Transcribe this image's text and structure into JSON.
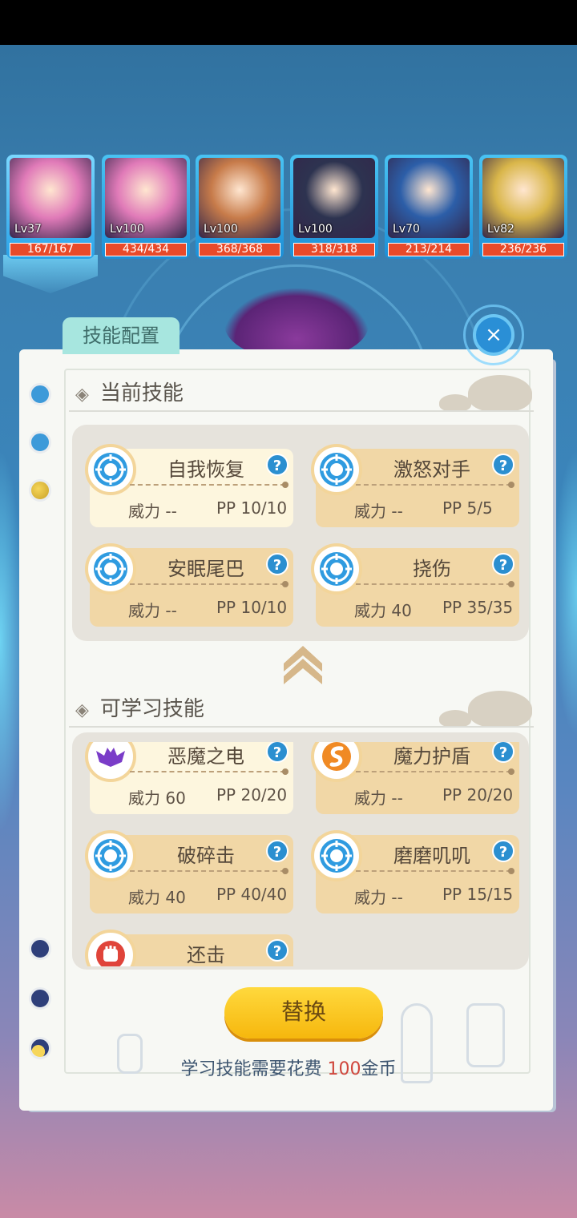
{
  "team": [
    {
      "level": "Lv37",
      "hp": "167/167",
      "active": true,
      "color": "#e07ab8"
    },
    {
      "level": "Lv100",
      "hp": "434/434",
      "active": false,
      "color": "#e07ab8"
    },
    {
      "level": "Lv100",
      "hp": "368/368",
      "active": false,
      "color": "#c77b4a"
    },
    {
      "level": "Lv100",
      "hp": "318/318",
      "active": false,
      "color": "#2d3350"
    },
    {
      "level": "Lv70",
      "hp": "213/214",
      "active": false,
      "color": "#2c5ea8"
    },
    {
      "level": "Lv82",
      "hp": "236/236",
      "active": false,
      "color": "#d9b64a"
    }
  ],
  "panel": {
    "tab_title": "技能配置",
    "close_label": "×"
  },
  "current_section": {
    "title": "当前技能",
    "skills": [
      {
        "name": "自我恢复",
        "power": "威力 --",
        "pp": "PP 10/10",
        "icon": "blue-target-icon",
        "selected": true
      },
      {
        "name": "激怒对手",
        "power": "威力 --",
        "pp": "PP 5/5",
        "icon": "blue-target-icon",
        "selected": false
      },
      {
        "name": "安眠尾巴",
        "power": "威力 --",
        "pp": "PP 10/10",
        "icon": "blue-target-icon",
        "selected": false
      },
      {
        "name": "挠伤",
        "power": "威力 40",
        "pp": "PP 35/35",
        "icon": "blue-target-icon",
        "selected": false
      }
    ]
  },
  "learnable_section": {
    "title": "可学习技能",
    "skills": [
      {
        "name": "恶魔之电",
        "power": "威力 60",
        "pp": "PP 20/20",
        "icon": "purple-bat-icon",
        "selected": true
      },
      {
        "name": "魔力护盾",
        "power": "威力 --",
        "pp": "PP 20/20",
        "icon": "orange-swirl-icon",
        "selected": false
      },
      {
        "name": "破碎击",
        "power": "威力 40",
        "pp": "PP 40/40",
        "icon": "blue-target-icon",
        "selected": false
      },
      {
        "name": "磨磨叽叽",
        "power": "威力 --",
        "pp": "PP 15/15",
        "icon": "blue-target-icon",
        "selected": false
      },
      {
        "name": "还击",
        "power": "",
        "pp": "",
        "icon": "red-fist-icon",
        "selected": false
      }
    ]
  },
  "help_label": "?",
  "replace_button": "替换",
  "cost": {
    "prefix": "学习技能需要花费 ",
    "amount": "100",
    "suffix": "金币"
  }
}
